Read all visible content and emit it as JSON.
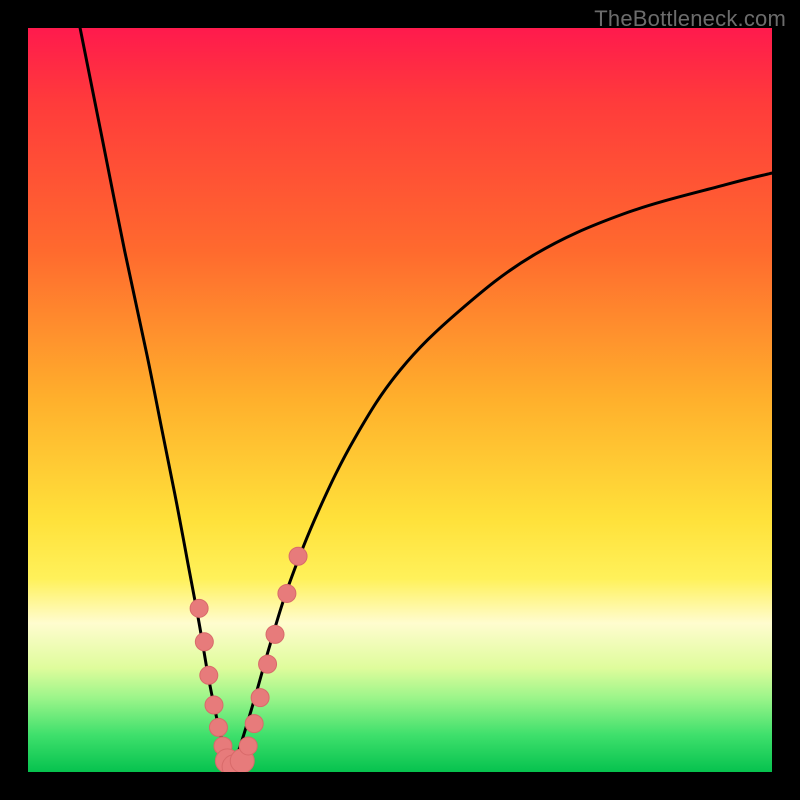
{
  "watermark": "TheBottleneck.com",
  "colors": {
    "curve": "#000000",
    "marker_fill": "#e77b7b",
    "marker_stroke": "#d86a6a"
  },
  "chart_data": {
    "type": "line",
    "title": "",
    "xlabel": "",
    "ylabel": "",
    "xlim": [
      0,
      100
    ],
    "ylim": [
      0,
      100
    ],
    "series": [
      {
        "name": "left-branch",
        "x": [
          7,
          10,
          13,
          16,
          18,
          20,
          21.5,
          23,
          24.2,
          25.2,
          26,
          26.7,
          27.2
        ],
        "y": [
          100,
          85,
          70,
          56,
          46,
          36,
          28,
          20,
          13,
          8,
          4.5,
          2,
          0.5
        ]
      },
      {
        "name": "right-branch",
        "x": [
          27.2,
          28,
          29,
          30.5,
          32.5,
          35,
          39,
          44,
          50,
          58,
          68,
          80,
          94,
          100
        ],
        "y": [
          0.5,
          2,
          5,
          10,
          17,
          25,
          35,
          45,
          54,
          62,
          69.5,
          75,
          79,
          80.5
        ]
      }
    ],
    "markers": [
      {
        "x": 23.0,
        "y": 22.0,
        "r": 9
      },
      {
        "x": 23.7,
        "y": 17.5,
        "r": 9
      },
      {
        "x": 24.3,
        "y": 13.0,
        "r": 9
      },
      {
        "x": 25.0,
        "y": 9.0,
        "r": 9
      },
      {
        "x": 25.6,
        "y": 6.0,
        "r": 9
      },
      {
        "x": 26.2,
        "y": 3.5,
        "r": 9
      },
      {
        "x": 26.8,
        "y": 1.5,
        "r": 12
      },
      {
        "x": 27.7,
        "y": 0.7,
        "r": 12
      },
      {
        "x": 28.8,
        "y": 1.5,
        "r": 12
      },
      {
        "x": 29.6,
        "y": 3.5,
        "r": 9
      },
      {
        "x": 30.4,
        "y": 6.5,
        "r": 9
      },
      {
        "x": 31.2,
        "y": 10.0,
        "r": 9
      },
      {
        "x": 32.2,
        "y": 14.5,
        "r": 9
      },
      {
        "x": 33.2,
        "y": 18.5,
        "r": 9
      },
      {
        "x": 34.8,
        "y": 24.0,
        "r": 9
      },
      {
        "x": 36.3,
        "y": 29.0,
        "r": 9
      }
    ]
  }
}
